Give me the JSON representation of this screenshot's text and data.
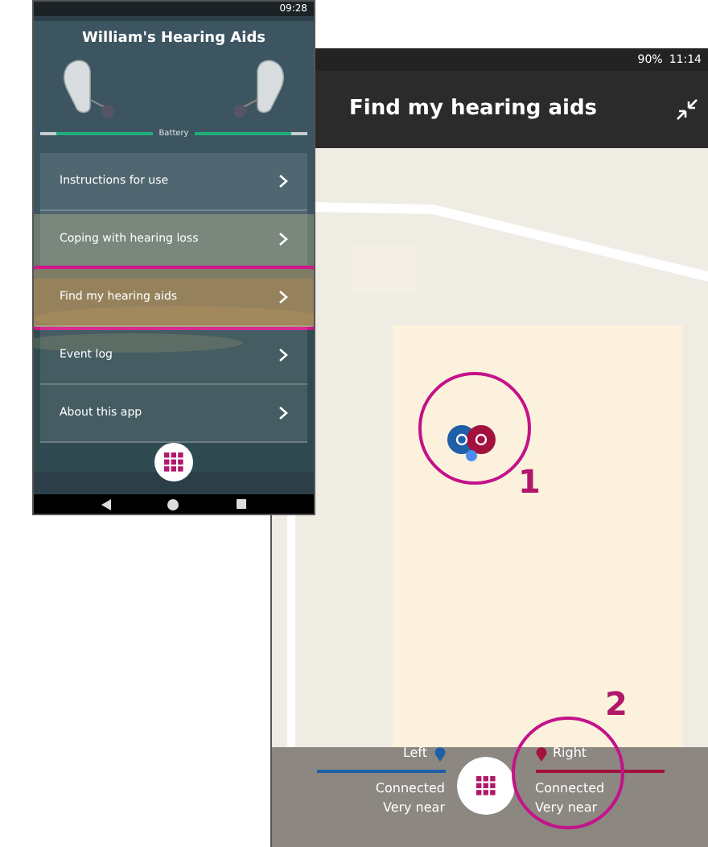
{
  "menu_phone": {
    "status_time": "09:28",
    "title": "William's Hearing Aids",
    "battery_label": "Battery",
    "batteries": [
      {
        "level": 0.85
      },
      {
        "level": 0.85
      }
    ],
    "items": [
      {
        "label": "Instructions for use",
        "highlighted": false
      },
      {
        "label": "Coping with hearing loss",
        "highlighted": false
      },
      {
        "label": "Find my hearing aids",
        "highlighted": true
      },
      {
        "label": "Event log",
        "highlighted": false
      },
      {
        "label": "About this app",
        "highlighted": false
      }
    ]
  },
  "map_phone": {
    "status_battery": "90%",
    "status_time": "11:14",
    "title": "Find my hearing aids",
    "devices": [
      {
        "label": "Left",
        "color": "#1f5fa8",
        "status": "Connected",
        "distance": "Very near"
      },
      {
        "label": "Right",
        "color": "#a3123f",
        "status": "Connected",
        "distance": "Very near"
      }
    ]
  },
  "annotations": [
    {
      "label": "1"
    },
    {
      "label": "2"
    }
  ]
}
